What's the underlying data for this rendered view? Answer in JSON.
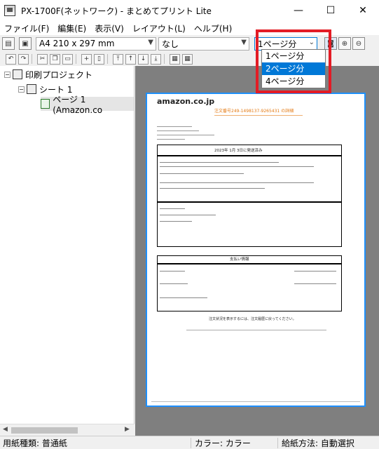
{
  "window": {
    "title": "PX-1700F(ネットワーク) - まとめてプリント Lite",
    "minimize": "—",
    "maximize": "☐",
    "close": "✕"
  },
  "menu": [
    {
      "label": "ファイル(F)"
    },
    {
      "label": "編集(E)"
    },
    {
      "label": "表示(V)"
    },
    {
      "label": "レイアウト(L)"
    },
    {
      "label": "ヘルプ(H)"
    }
  ],
  "toolbar": {
    "paper_size": "A4 210 x 297 mm",
    "mode_value": "なし",
    "pages_per_sheet": "1ページ分",
    "dropdown_options": [
      "1ページ分",
      "2ページ分",
      "4ページ分"
    ],
    "selected_option_index": 1
  },
  "tree": {
    "project": "印刷プロジェクト",
    "sheet": "シート 1",
    "page": "ページ 1 (Amazon.co"
  },
  "document": {
    "logo": "amazon.co.jp",
    "order_title": "注文番号249-1498137-9265431 の詳細",
    "order_date_heading": "2023年 1月 3日に発送済み",
    "payment_heading": "支払い情報",
    "footer_text": "注文状況を表示するには、注文履歴に戻ってください。"
  },
  "status": {
    "paper_type": "用紙種類: 普通紙",
    "color": "カラー: カラー",
    "feed": "給紙方法: 自動選択"
  }
}
